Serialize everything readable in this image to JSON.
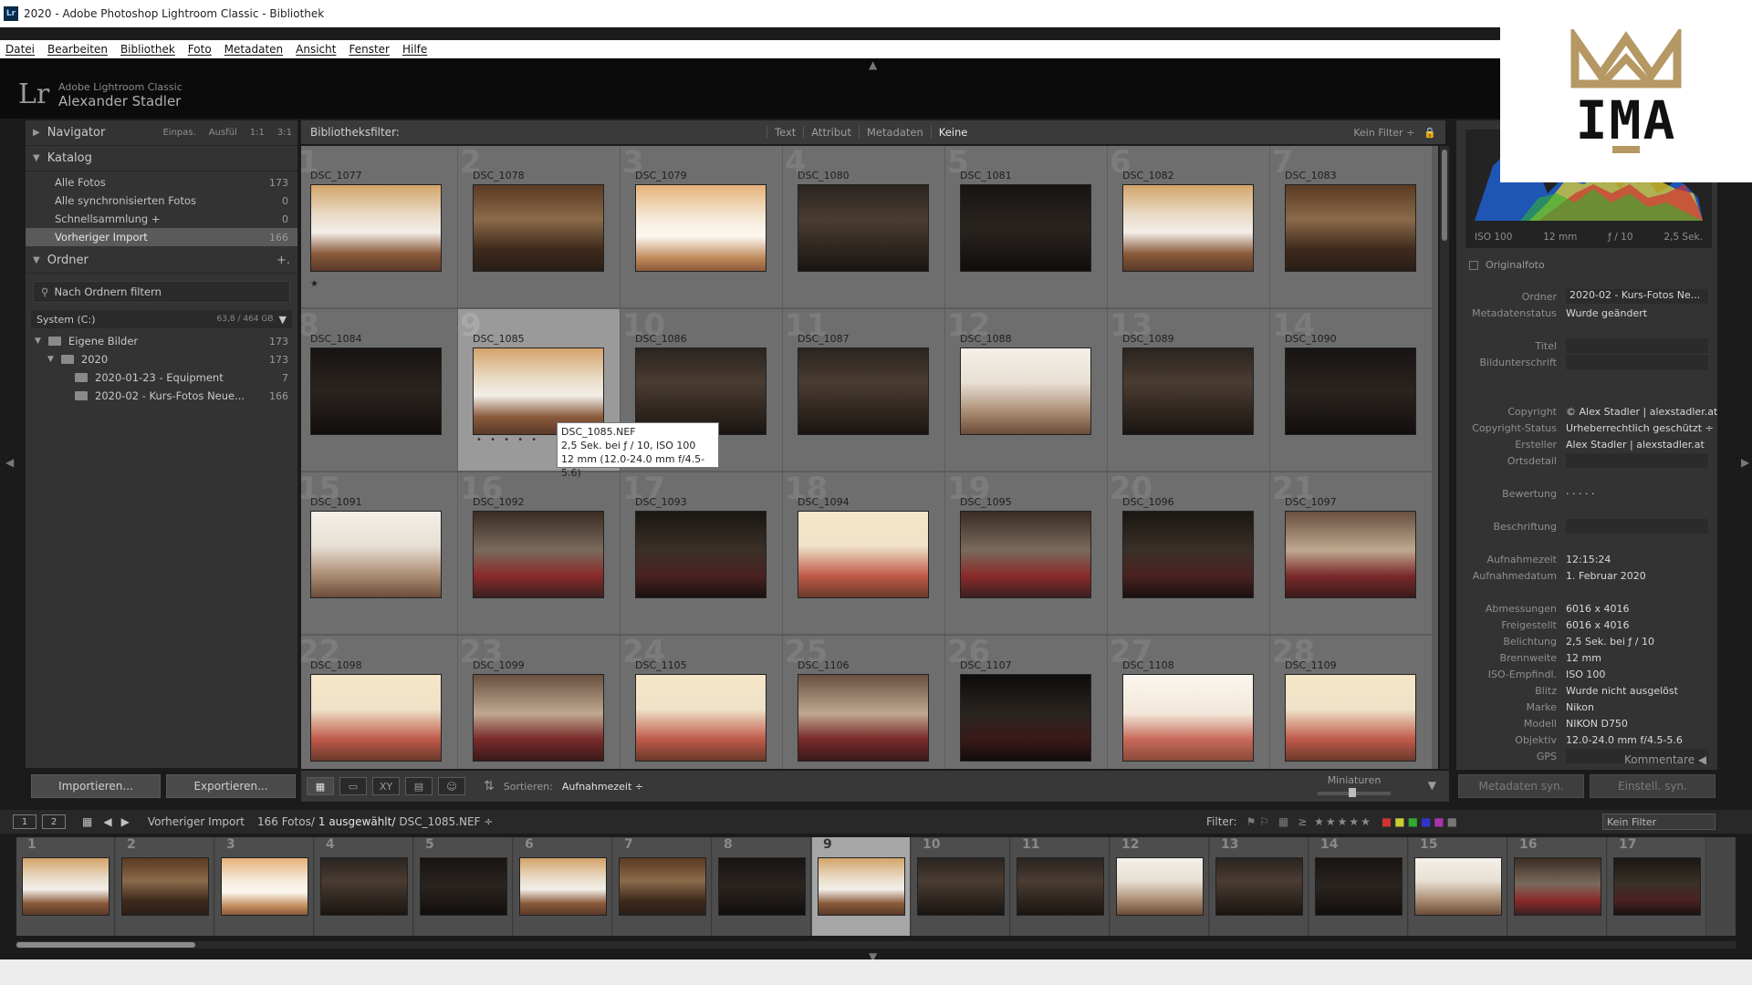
{
  "window": {
    "title": "2020 - Adobe Photoshop Lightroom Classic - Bibliothek",
    "app_icon": "Lr"
  },
  "menu": [
    "Datei",
    "Bearbeiten",
    "Bibliothek",
    "Foto",
    "Metadaten",
    "Ansicht",
    "Fenster",
    "Hilfe"
  ],
  "identity": {
    "logo": "Lr",
    "product": "Adobe Lightroom Classic",
    "user": "Alexander Stadler"
  },
  "navigator": {
    "title": "Navigator",
    "zoom": [
      "Einpas.",
      "Ausfül",
      "1:1",
      "3:1"
    ]
  },
  "katalog": {
    "title": "Katalog",
    "items": [
      {
        "label": "Alle Fotos",
        "count": "173"
      },
      {
        "label": "Alle synchronisierten Fotos",
        "count": "0"
      },
      {
        "label": "Schnellsammlung +",
        "count": "0"
      },
      {
        "label": "Vorheriger Import",
        "count": "166"
      }
    ]
  },
  "ordner": {
    "title": "Ordner",
    "add": "+.",
    "search_placeholder": "Nach Ordnern filtern",
    "volume": {
      "label": "System (C:)",
      "size": "63,8 / 464 GB"
    },
    "tree": [
      {
        "label": "Eigene Bilder",
        "count": "173"
      },
      {
        "label": "2020",
        "count": "173"
      },
      {
        "label": "2020-01-23 - Equipment",
        "count": "7"
      },
      {
        "label": "2020-02 - Kurs-Fotos Neue...",
        "count": "166"
      }
    ]
  },
  "left_buttons": {
    "import": "Importieren...",
    "export": "Exportieren..."
  },
  "filterbar": {
    "label": "Bibliotheksfilter:",
    "tabs": [
      "Text",
      "Attribut",
      "Metadaten",
      "Keine"
    ],
    "preset": "Kein Filter ÷"
  },
  "grid": [
    {
      "num": "1",
      "name": "DSC_1077",
      "style": "ph-a",
      "star": "★"
    },
    {
      "num": "2",
      "name": "DSC_1078",
      "style": "ph-b"
    },
    {
      "num": "3",
      "name": "DSC_1079",
      "style": "ph-c"
    },
    {
      "num": "4",
      "name": "DSC_1080",
      "style": "ph-d"
    },
    {
      "num": "5",
      "name": "DSC_1081",
      "style": "ph-e"
    },
    {
      "num": "6",
      "name": "DSC_1082",
      "style": "ph-a"
    },
    {
      "num": "7",
      "name": "DSC_1083",
      "style": "ph-b"
    },
    {
      "num": "8",
      "name": "DSC_1084",
      "style": "ph-e"
    },
    {
      "num": "9",
      "name": "DSC_1085",
      "style": "ph-a",
      "selected": true,
      "dots": "• • • • •"
    },
    {
      "num": "10",
      "name": "DSC_1086",
      "style": "ph-d"
    },
    {
      "num": "11",
      "name": "DSC_1087",
      "style": "ph-d"
    },
    {
      "num": "12",
      "name": "DSC_1088",
      "style": "ph-f"
    },
    {
      "num": "13",
      "name": "DSC_1089",
      "style": "ph-d"
    },
    {
      "num": "14",
      "name": "DSC_1090",
      "style": "ph-e"
    },
    {
      "num": "15",
      "name": "DSC_1091",
      "style": "ph-f"
    },
    {
      "num": "16",
      "name": "DSC_1092",
      "style": "ph-g"
    },
    {
      "num": "17",
      "name": "DSC_1093",
      "style": "ph-h"
    },
    {
      "num": "18",
      "name": "DSC_1094",
      "style": "ph-i"
    },
    {
      "num": "19",
      "name": "DSC_1095",
      "style": "ph-g"
    },
    {
      "num": "20",
      "name": "DSC_1096",
      "style": "ph-h"
    },
    {
      "num": "21",
      "name": "DSC_1097",
      "style": "ph-l"
    },
    {
      "num": "22",
      "name": "DSC_1098",
      "style": "ph-i"
    },
    {
      "num": "23",
      "name": "DSC_1099",
      "style": "ph-l"
    },
    {
      "num": "24",
      "name": "DSC_1105",
      "style": "ph-i"
    },
    {
      "num": "25",
      "name": "DSC_1106",
      "style": "ph-l"
    },
    {
      "num": "26",
      "name": "DSC_1107",
      "style": "ph-k"
    },
    {
      "num": "27",
      "name": "DSC_1108",
      "style": "ph-j"
    },
    {
      "num": "28",
      "name": "DSC_1109",
      "style": "ph-i"
    }
  ],
  "tooltip": [
    "DSC_1085.NEF",
    "2,5 Sek. bei ƒ / 10, ISO 100",
    "12 mm (12.0-24.0 mm f/4.5-5.6)"
  ],
  "toolbar": {
    "sort_label": "Sortieren:",
    "sort_value": "Aufnahmezeit ÷",
    "mini_label": "Miniaturen"
  },
  "histogram": {
    "iso": "ISO 100",
    "focal": "12 mm",
    "aperture": "ƒ / 10",
    "shutter": "2,5 Sek."
  },
  "originalfoto": "Originalfoto",
  "metadata": [
    {
      "k": "Ordner",
      "v": "2020-02 - Kurs-Fotos Ne...",
      "box": true
    },
    {
      "k": "Metadatenstatus",
      "v": "Wurde geändert"
    },
    {
      "k": "",
      "v": ""
    },
    {
      "k": "Titel",
      "v": "",
      "box": true
    },
    {
      "k": "Bildunterschrift",
      "v": "",
      "box": true
    },
    {
      "k": "",
      "v": ""
    },
    {
      "k": "",
      "v": ""
    },
    {
      "k": "Copyright",
      "v": "© Alex Stadler | alexstadler.at"
    },
    {
      "k": "Copyright-Status",
      "v": "Urheberrechtlich geschützt ÷"
    },
    {
      "k": "Ersteller",
      "v": "Alex Stadler | alexstadler.at"
    },
    {
      "k": "Ortsdetail",
      "v": "",
      "box": true
    },
    {
      "k": "",
      "v": ""
    },
    {
      "k": "Bewertung",
      "v": "· · · · ·"
    },
    {
      "k": "",
      "v": ""
    },
    {
      "k": "Beschriftung",
      "v": "",
      "box": true
    },
    {
      "k": "",
      "v": ""
    },
    {
      "k": "Aufnahmezeit",
      "v": "12:15:24"
    },
    {
      "k": "Aufnahmedatum",
      "v": "1. Februar 2020"
    },
    {
      "k": "",
      "v": ""
    },
    {
      "k": "Abmessungen",
      "v": "6016 x 4016"
    },
    {
      "k": "Freigestellt",
      "v": "6016 x 4016"
    },
    {
      "k": "Belichtung",
      "v": "2,5 Sek. bei ƒ / 10"
    },
    {
      "k": "Brennweite",
      "v": "12 mm"
    },
    {
      "k": "ISO-Empfindl.",
      "v": "ISO 100"
    },
    {
      "k": "Blitz",
      "v": "Wurde nicht ausgelöst"
    },
    {
      "k": "Marke",
      "v": "Nikon"
    },
    {
      "k": "Modell",
      "v": "NIKON D750"
    },
    {
      "k": "Objektiv",
      "v": "12.0-24.0 mm f/4.5-5.6"
    },
    {
      "k": "GPS",
      "v": "",
      "box": true
    }
  ],
  "kommentare": "Kommentare",
  "right_buttons": {
    "sync_meta": "Metadaten syn.",
    "sync_settings": "Einstell. syn."
  },
  "filmstrip_bar": {
    "monitor1": "1",
    "monitor2": "2",
    "source": "Vorheriger Import",
    "count": "166 Fotos/",
    "selected": "1 ausgewählt/",
    "file": "DSC_1085.NEF ÷",
    "filter_label": "Filter:",
    "filter_value": "Kein Filter"
  },
  "filmstrip": [
    {
      "num": "1",
      "style": "ph-a"
    },
    {
      "num": "2",
      "style": "ph-b"
    },
    {
      "num": "3",
      "style": "ph-c"
    },
    {
      "num": "4",
      "style": "ph-d"
    },
    {
      "num": "5",
      "style": "ph-e"
    },
    {
      "num": "6",
      "style": "ph-a"
    },
    {
      "num": "7",
      "style": "ph-b"
    },
    {
      "num": "8",
      "style": "ph-e"
    },
    {
      "num": "9",
      "style": "ph-a",
      "selected": true
    },
    {
      "num": "10",
      "style": "ph-d"
    },
    {
      "num": "11",
      "style": "ph-d"
    },
    {
      "num": "12",
      "style": "ph-f"
    },
    {
      "num": "13",
      "style": "ph-d"
    },
    {
      "num": "14",
      "style": "ph-e"
    },
    {
      "num": "15",
      "style": "ph-f"
    },
    {
      "num": "16",
      "style": "ph-g"
    },
    {
      "num": "17",
      "style": "ph-h"
    }
  ],
  "watermark": {
    "text": "IMA",
    "color": "#b59863"
  }
}
